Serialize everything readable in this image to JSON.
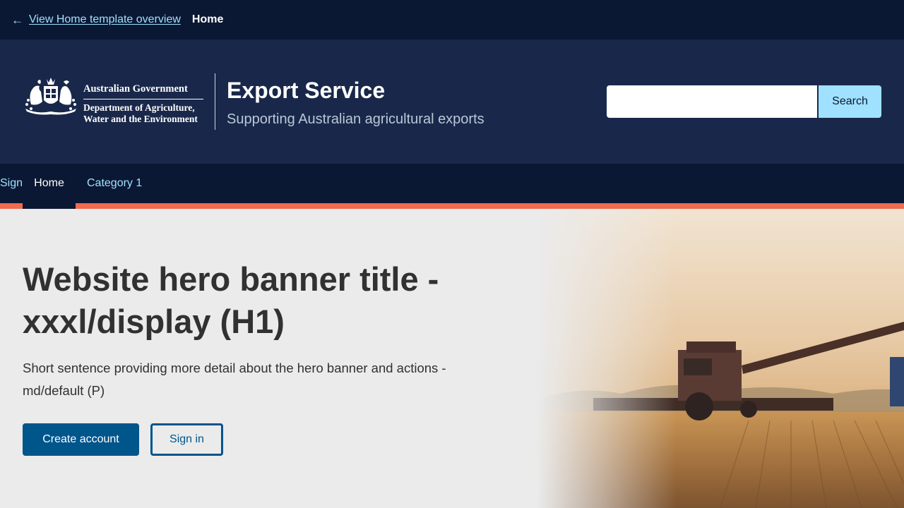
{
  "topbar": {
    "back_icon": "arrow-left-icon",
    "back_link": "View Home template overview",
    "current_page": "Home"
  },
  "header": {
    "logo_icon": "coat-of-arms-icon",
    "gov_name": "Australian Government",
    "dept_line1": "Department of Agriculture,",
    "dept_line2": "Water and the Environment",
    "service_title": "Export Service",
    "service_subtitle": "Supporting Australian agricultural exports",
    "search": {
      "value": "",
      "placeholder": "",
      "button_label": "Search"
    }
  },
  "nav": {
    "items": [
      {
        "label": "Home",
        "active": true
      },
      {
        "label": "Category 1",
        "active": false
      }
    ],
    "signin_label": "Sign in",
    "signin_icon": "user-circle-icon"
  },
  "hero": {
    "title": "Website hero banner title - xxxl/display (H1)",
    "description": "Short sentence providing more detail about the hero banner and actions - md/default (P)",
    "primary_button": "Create account",
    "secondary_button": "Sign in",
    "image": "combine-harvester-wheat-field-image"
  },
  "colors": {
    "topbar_bg": "#0b1833",
    "header_bg": "#19284a",
    "link": "#9fe1ff",
    "accent": "#f06b4f",
    "primary": "#00558b",
    "hero_bg": "#ebebeb",
    "text": "#313131"
  }
}
